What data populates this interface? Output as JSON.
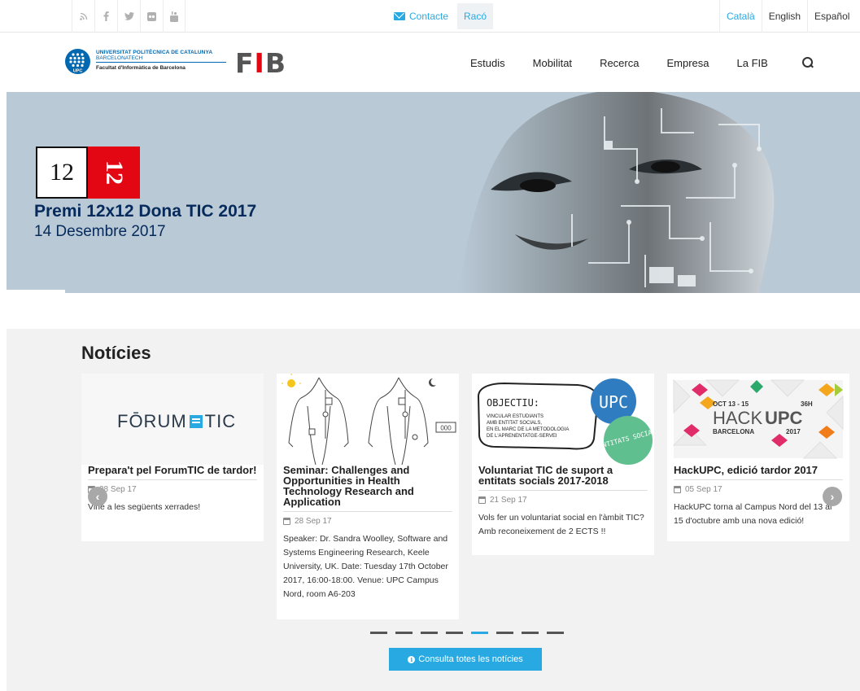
{
  "topbar": {
    "social": [
      {
        "icon": "rss-icon"
      },
      {
        "icon": "facebook-icon"
      },
      {
        "icon": "twitter-icon"
      },
      {
        "icon": "flickr-icon"
      },
      {
        "icon": "youtube-icon"
      }
    ],
    "contact_label": "Contacte",
    "raco_label": "Racó",
    "languages": [
      {
        "label": "Català",
        "active": true
      },
      {
        "label": "English",
        "active": false
      },
      {
        "label": "Español",
        "active": false
      }
    ]
  },
  "header": {
    "logo_line1": "UNIVERSITAT POLITÈCNICA DE CATALUNYA",
    "logo_line2": "BARCELONATECH",
    "logo_line3": "Facultat d'Informàtica de Barcelona",
    "logo_badge": "UPC",
    "fib": {
      "f": "F",
      "i": "I",
      "b": "B"
    },
    "nav": [
      "Estudis",
      "Mobilitat",
      "Recerca",
      "Empresa",
      "La FIB"
    ]
  },
  "hero": {
    "badge_left": "12",
    "badge_right": "12",
    "title": "Premi 12x12 Dona TIC 2017",
    "date": "14 Desembre 2017"
  },
  "news": {
    "heading": "Notícies",
    "cards": [
      {
        "image_text": "FŌRUM",
        "image_text2": "TIC",
        "title": "Prepara't pel ForumTIC de tardor!",
        "date": "28 Sep 17",
        "desc": "Vine a les següents xerrades!"
      },
      {
        "image_text": "000",
        "title": "Seminar: Challenges and Opportunities in Health Technology Research and Application",
        "date": "28 Sep 17",
        "desc": "Speaker: Dr. Sandra Woolley, Software and Systems Engineering Research, Keele University, UK. Date: Tuesday 17th October 2017, 16:00-18:00. Venue: UPC Campus Nord, room A6-203"
      },
      {
        "image_text": "OBJECTIU:",
        "image_lines": [
          "VINCULAR ESTUDIANTS",
          "AMB ENTITAT SOCIALS,",
          "EN EL MARC DE LA METODOLOGIA",
          "DE L'APRENENTATGE-SERVEI"
        ],
        "image_upc": "UPC",
        "image_green": "ENTITATS SOCIALS",
        "title": "Voluntariat TIC de suport a entitats socials 2017-2018",
        "date": "21 Sep 17",
        "desc": "Vols fer un voluntariat social en l'àmbit TIC? Amb reconeixement de 2 ECTS !!"
      },
      {
        "image_dates": "OCT 13 - 15",
        "image_hours": "36H",
        "image_hack": "HACK",
        "image_upc": "UPC",
        "image_city": "BARCELONA",
        "image_year": "2017",
        "title": "HackUPC, edició tardor 2017",
        "date": "05 Sep 17",
        "desc": "HackUPC torna al Campus Nord del 13 al 15 d'octubre amb una nova edició!"
      }
    ],
    "pager_count": 8,
    "pager_active": 5,
    "cta_label": "Consulta totes les notícies"
  },
  "colors": {
    "accent": "#29a9e1",
    "brand_red": "#e30613",
    "upc_blue": "#0067b1",
    "hero_text": "#062a5c"
  }
}
